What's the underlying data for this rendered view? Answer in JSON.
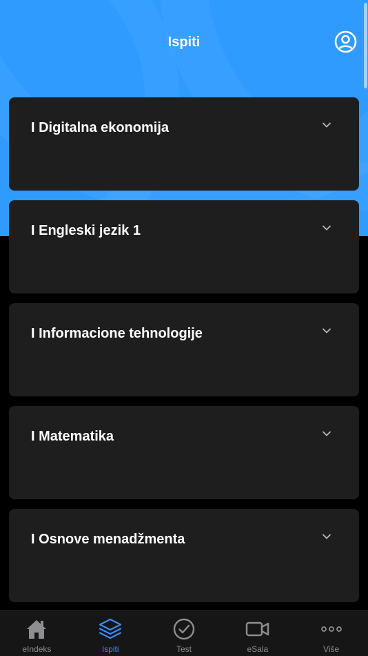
{
  "header": {
    "title": "Ispiti",
    "profile_icon": "user-circle-icon"
  },
  "colors": {
    "accent": "#2f9bff",
    "card_background": "#1e1e1f",
    "page_background": "#000000",
    "tab_active": "#3a8dff",
    "tab_inactive": "#8e8e92"
  },
  "courses": [
    {
      "title": "I Digitalna ekonomija",
      "icon": "chevron-down-icon"
    },
    {
      "title": "I Engleski jezik 1",
      "icon": "chevron-down-icon"
    },
    {
      "title": "I Informacione tehnologije",
      "icon": "chevron-down-icon"
    },
    {
      "title": "I Matematika",
      "icon": "chevron-down-icon"
    },
    {
      "title": "I Osnove menadžmenta",
      "icon": "chevron-down-icon"
    }
  ],
  "tabbar": {
    "active_tab": "Ispiti",
    "tabs": [
      {
        "label": "eIndeks",
        "icon": "home-icon"
      },
      {
        "label": "Ispiti",
        "icon": "layers-icon"
      },
      {
        "label": "Test",
        "icon": "check-circle-icon"
      },
      {
        "label": "eSala",
        "icon": "video-camera-icon"
      },
      {
        "label": "Više",
        "icon": "more-dots-icon"
      }
    ]
  }
}
